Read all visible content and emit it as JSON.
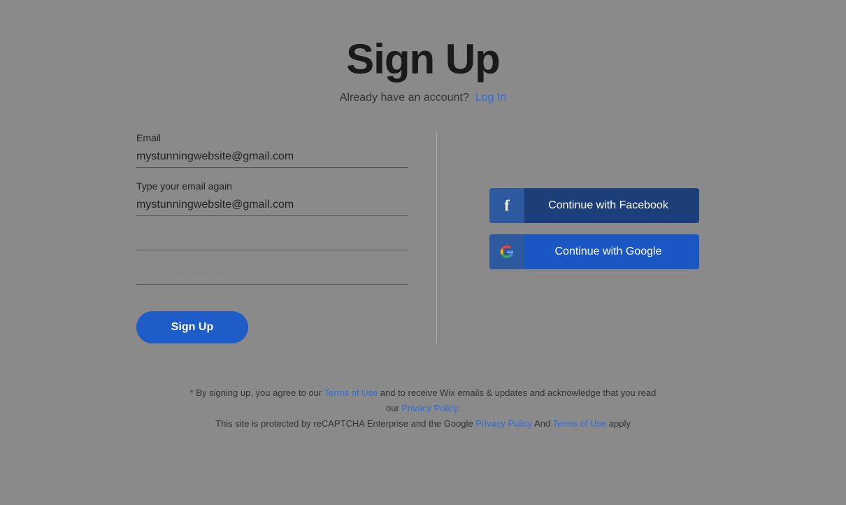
{
  "page": {
    "title": "Sign Up",
    "subtitle_text": "Already have an account?",
    "login_link": "Log In"
  },
  "form": {
    "email_label": "Email",
    "email_value": "mystunningwebsite@gmail.com",
    "email_confirm_label": "Type your email again",
    "email_confirm_value": "mystunningwebsite@gmail.com",
    "password_placeholder": "Password",
    "password_confirm_placeholder": "Type your password again",
    "submit_button": "Sign Up"
  },
  "social": {
    "facebook_label": "Continue with Facebook",
    "google_label": "Continue with Google"
  },
  "footer": {
    "line1_pre": "* By signing up, you agree to our ",
    "terms_link1": "Terms of Use",
    "line1_mid": " and to receive Wix emails & updates and acknowledge that you read our ",
    "privacy_link1": "Privacy Policy",
    "line1_post": ".",
    "line2_pre": "This site is protected by reCAPTCHA Enterprise and the Google ",
    "privacy_link2": "Privacy Policy",
    "line2_mid": " And ",
    "terms_link2": "Terms of Use",
    "line2_post": " apply"
  }
}
